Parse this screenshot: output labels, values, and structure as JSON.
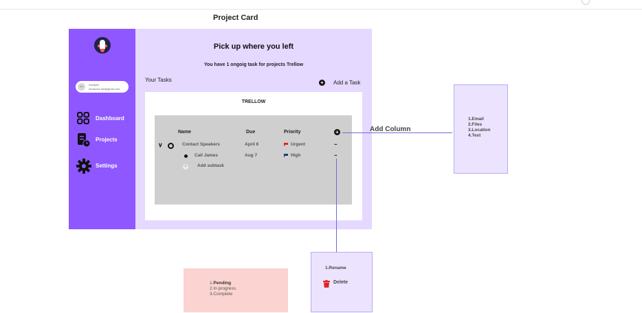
{
  "page_title": "Project Card",
  "sidebar": {
    "user": {
      "initials": "MJ",
      "name": "madiyee",
      "email": "mmaures.aw@gmail.com"
    },
    "items": [
      {
        "label": "Dashboard",
        "icon": "grid-icon"
      },
      {
        "label": "Projects",
        "icon": "projects-icon"
      },
      {
        "label": "Settings",
        "icon": "gear-icon"
      }
    ]
  },
  "main": {
    "greeting": "Pick up where you left",
    "subtitle": "You have 1 ongoig task for projects Trellow",
    "your_tasks": "Your Tasks",
    "add_task": "Add a Task",
    "board": {
      "title": "TRELLOW",
      "headers": {
        "name": "Name",
        "due": "Due",
        "priority": "Priority"
      },
      "rows": [
        {
          "name": "Contact Speakers",
          "due": "April 6",
          "priority": "Urgent",
          "more": "..."
        },
        {
          "name": "Call James",
          "due": "Aug 7",
          "priority": "High",
          "more": "..."
        }
      ],
      "add_subtask": "Add subtask"
    }
  },
  "annotations": {
    "add_column": "Add Column"
  },
  "column_types_menu": {
    "items": [
      "1.Email",
      "2.Files",
      "3.Location",
      "4.Text"
    ]
  },
  "row_actions_menu": {
    "rename": "1.Rename",
    "delete": "Delete"
  },
  "status_menu": {
    "items": [
      {
        "num": "1.",
        "label": "Pending"
      },
      {
        "num": "2.",
        "label": "In progress"
      },
      {
        "num": "3.",
        "label": "Complete"
      }
    ]
  },
  "colors": {
    "sidebar": "#8f57ff",
    "main_bg": "#e5d9ff",
    "urgent_flag": "#e02424",
    "high_flag": "#1f3b73",
    "delete_icon": "#e02424"
  }
}
